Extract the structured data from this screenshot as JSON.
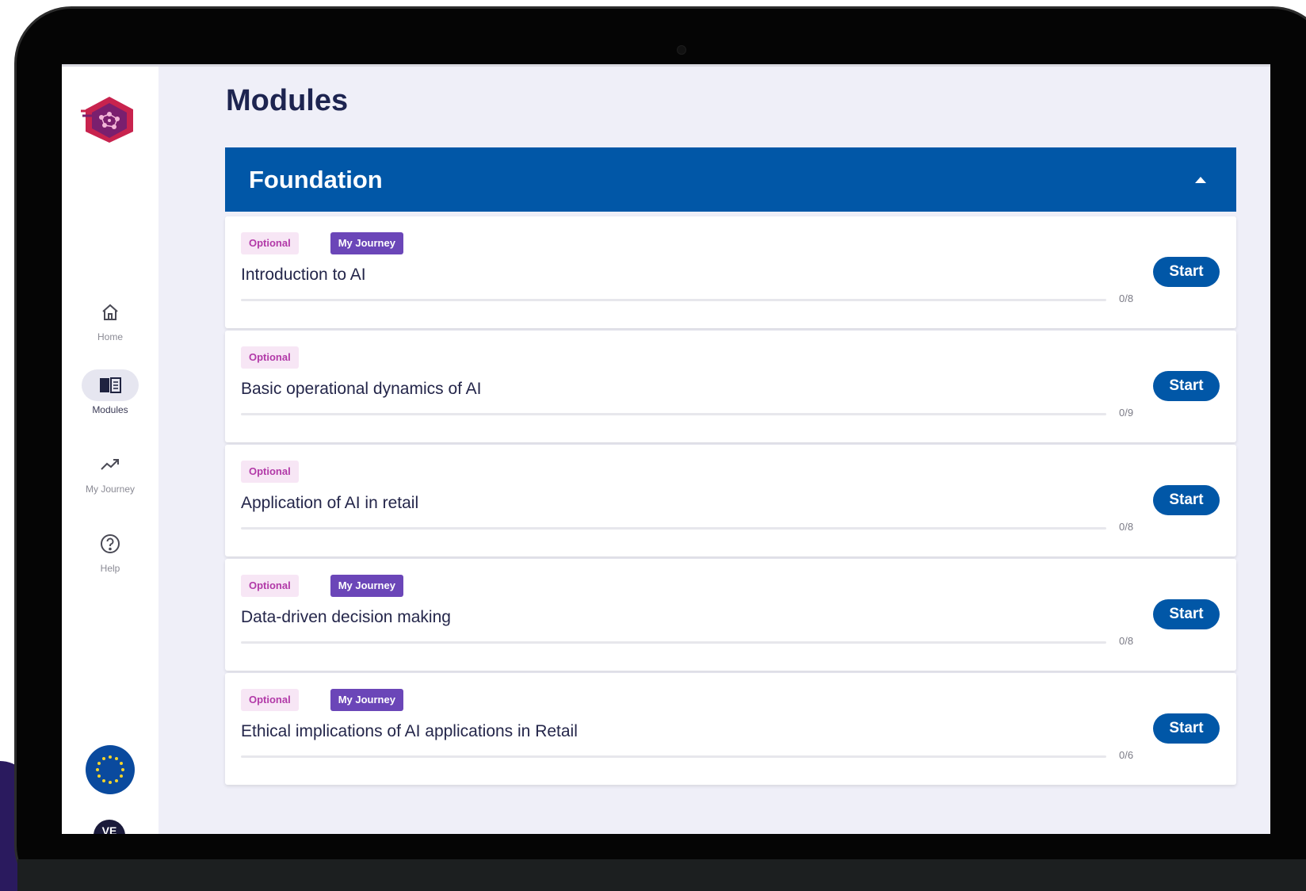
{
  "sidebar": {
    "nav": [
      {
        "label": "Home",
        "icon": "home-icon",
        "active": false
      },
      {
        "label": "Modules",
        "icon": "book-icon",
        "active": true
      },
      {
        "label": "My Journey",
        "icon": "trending-up-icon",
        "active": false
      },
      {
        "label": "Help",
        "icon": "help-circle-icon",
        "active": false
      }
    ],
    "avatar_initials": "VE"
  },
  "page": {
    "title": "Modules"
  },
  "section": {
    "title": "Foundation",
    "expanded": true
  },
  "modules": [
    {
      "optional_tag": "Optional",
      "journey_tag": "My Journey",
      "title": "Introduction to AI",
      "progress_text": "0/8",
      "progress_fraction": 0,
      "start_label": "Start"
    },
    {
      "optional_tag": "Optional",
      "journey_tag": null,
      "title": "Basic operational dynamics of AI",
      "progress_text": "0/9",
      "progress_fraction": 0,
      "start_label": "Start"
    },
    {
      "optional_tag": "Optional",
      "journey_tag": null,
      "title": "Application of AI in retail",
      "progress_text": "0/8",
      "progress_fraction": 0,
      "start_label": "Start"
    },
    {
      "optional_tag": "Optional",
      "journey_tag": "My Journey",
      "title": "Data-driven decision making",
      "progress_text": "0/8",
      "progress_fraction": 0,
      "start_label": "Start"
    },
    {
      "optional_tag": "Optional",
      "journey_tag": "My Journey",
      "title": "Ethical implications of AI applications in Retail",
      "progress_text": "0/6",
      "progress_fraction": 0,
      "start_label": "Start"
    }
  ],
  "colors": {
    "primary": "#0157a7",
    "optional_tag_bg": "#f7e6f5",
    "optional_tag_text": "#b23aa8",
    "journey_tag_bg": "#6b46b8",
    "page_bg": "#efeff8",
    "title_text": "#1d2450"
  }
}
